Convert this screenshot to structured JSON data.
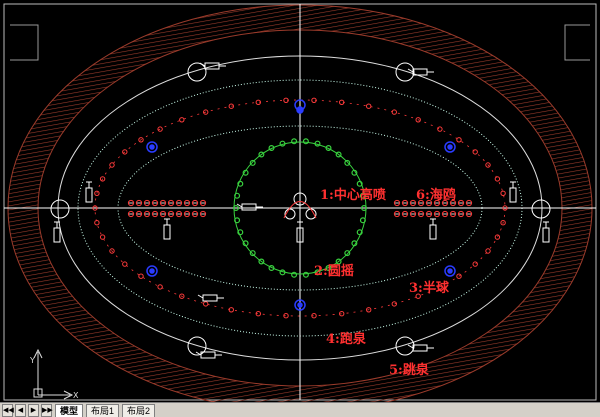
{
  "labels": {
    "center_high": "1:中心高喷",
    "seagull": "6:海鸥",
    "shake": "2:圆摇",
    "hemisphere": "3:半球",
    "running": "4:跑泉",
    "jumping": "5:跳泉"
  },
  "ucs": {
    "y_axis": "Y",
    "x_axis": "X"
  },
  "layout_tabs": [
    {
      "label": "模型",
      "active": true
    },
    {
      "label": "布局1",
      "active": false
    },
    {
      "label": "布局2",
      "active": false
    }
  ],
  "nav_buttons": [
    "◀◀",
    "◀",
    "▶",
    "▶▶"
  ],
  "colors": {
    "background": "#000000",
    "outer_hatch": "#9b3b2b",
    "nozzle_red": "#ff3b3b",
    "ring_green": "#39d23f",
    "dotted_white": "#ccffee",
    "blue_light": "#2a3cff",
    "crosshair": "#ffffff"
  }
}
